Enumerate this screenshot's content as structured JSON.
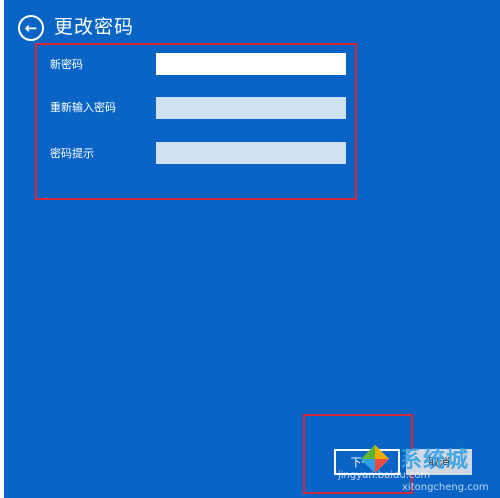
{
  "header": {
    "back_icon": "back-arrow-icon",
    "title": "更改密码"
  },
  "form": {
    "new_password_label": "新密码",
    "new_password_value": "",
    "reenter_password_label": "重新输入密码",
    "reenter_password_value": "",
    "hint_label": "密码提示",
    "hint_value": ""
  },
  "footer": {
    "next_label": "下一步",
    "cancel_label": "取消"
  },
  "watermark": {
    "brand": "系统城",
    "url": "xitongcheng.com",
    "baidu": "jingyan.baidu.com"
  },
  "colors": {
    "background": "#0a64c6",
    "highlight": "#d1283d",
    "input_active": "#ffffff",
    "input_inactive": "#cfe0f2"
  }
}
